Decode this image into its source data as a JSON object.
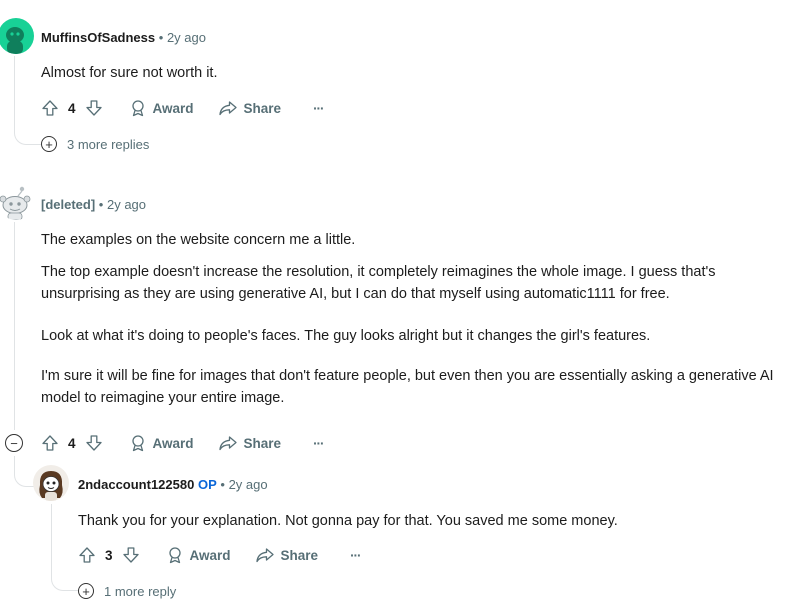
{
  "comments": [
    {
      "author": "MuffinsOfSadness",
      "separator": "•",
      "time": "2y ago",
      "paragraphs": [
        "Almost for sure not worth it."
      ],
      "votes": "4",
      "award_label": "Award",
      "share_label": "Share",
      "more_label": "···",
      "more_replies": "3 more replies"
    },
    {
      "author": "[deleted]",
      "separator": "•",
      "time": "2y ago",
      "paragraphs": [
        "The examples on the website concern me a little.",
        "The top example doesn't increase the resolution, it completely reimagines the whole image. I guess that's unsurprising as they are using generative AI, but I can do that myself using automatic1111 for free.",
        "Look at what it's doing to people's faces. The guy looks alright but it changes the girl's features.",
        "I'm sure it will be fine for images that don't feature people, but even then you are essentially asking a generative AI model to reimagine your entire image."
      ],
      "votes": "4",
      "award_label": "Award",
      "share_label": "Share",
      "more_label": "···",
      "collapse_symbol": "−"
    },
    {
      "author": "2ndaccount122580",
      "op_badge": "OP",
      "separator": "•",
      "time": "2y ago",
      "paragraphs": [
        "Thank you for your explanation. Not gonna pay for that. You saved me some money."
      ],
      "votes": "3",
      "award_label": "Award",
      "share_label": "Share",
      "more_label": "···",
      "more_replies": "1 more reply"
    }
  ],
  "expand_symbol": "+",
  "colors": {
    "accent_green": "#18d196",
    "op_blue": "#0a66d8",
    "meta_gray": "#576f76"
  }
}
